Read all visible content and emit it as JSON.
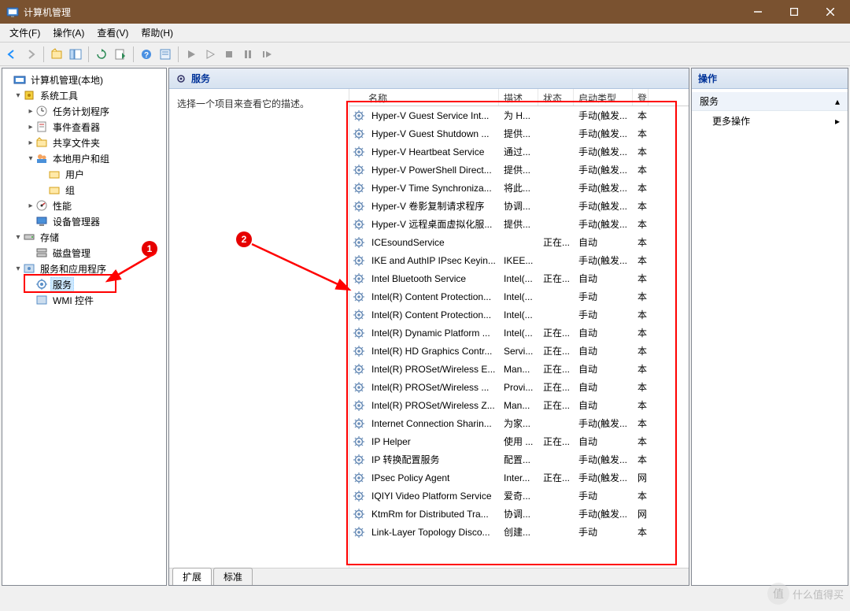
{
  "window": {
    "title": "计算机管理"
  },
  "menus": [
    "文件(F)",
    "操作(A)",
    "查看(V)",
    "帮助(H)"
  ],
  "tree": {
    "root": "计算机管理(本地)",
    "system_tools": "系统工具",
    "task_scheduler": "任务计划程序",
    "event_viewer": "事件查看器",
    "shared_folders": "共享文件夹",
    "local_users": "本地用户和组",
    "users": "用户",
    "groups": "组",
    "performance": "性能",
    "device_manager": "设备管理器",
    "storage": "存储",
    "disk_management": "磁盘管理",
    "services_apps": "服务和应用程序",
    "services": "服务",
    "wmi": "WMI 控件"
  },
  "center": {
    "header": "服务",
    "hint": "选择一个项目来查看它的描述。",
    "columns": {
      "name": "名称",
      "desc": "描述",
      "status": "状态",
      "startup": "启动类型",
      "logon": "登"
    },
    "tabs": {
      "extended": "扩展",
      "standard": "标准"
    }
  },
  "services_list": [
    {
      "name": "Hyper-V Guest Service Int...",
      "desc": "为 H...",
      "status": "",
      "startup": "手动(触发...",
      "logon": "本"
    },
    {
      "name": "Hyper-V Guest Shutdown ...",
      "desc": "提供...",
      "status": "",
      "startup": "手动(触发...",
      "logon": "本"
    },
    {
      "name": "Hyper-V Heartbeat Service",
      "desc": "通过...",
      "status": "",
      "startup": "手动(触发...",
      "logon": "本"
    },
    {
      "name": "Hyper-V PowerShell Direct...",
      "desc": "提供...",
      "status": "",
      "startup": "手动(触发...",
      "logon": "本"
    },
    {
      "name": "Hyper-V Time Synchroniza...",
      "desc": "将此...",
      "status": "",
      "startup": "手动(触发...",
      "logon": "本"
    },
    {
      "name": "Hyper-V 卷影复制请求程序",
      "desc": "协调...",
      "status": "",
      "startup": "手动(触发...",
      "logon": "本"
    },
    {
      "name": "Hyper-V 远程桌面虚拟化服...",
      "desc": "提供...",
      "status": "",
      "startup": "手动(触发...",
      "logon": "本"
    },
    {
      "name": "ICEsoundService",
      "desc": "",
      "status": "正在...",
      "startup": "自动",
      "logon": "本"
    },
    {
      "name": "IKE and AuthIP IPsec Keyin...",
      "desc": "IKEE...",
      "status": "",
      "startup": "手动(触发...",
      "logon": "本"
    },
    {
      "name": "Intel Bluetooth Service",
      "desc": "Intel(...",
      "status": "正在...",
      "startup": "自动",
      "logon": "本"
    },
    {
      "name": "Intel(R) Content Protection...",
      "desc": "Intel(...",
      "status": "",
      "startup": "手动",
      "logon": "本"
    },
    {
      "name": "Intel(R) Content Protection...",
      "desc": "Intel(...",
      "status": "",
      "startup": "手动",
      "logon": "本"
    },
    {
      "name": "Intel(R) Dynamic Platform ...",
      "desc": "Intel(...",
      "status": "正在...",
      "startup": "自动",
      "logon": "本"
    },
    {
      "name": "Intel(R) HD Graphics Contr...",
      "desc": "Servi...",
      "status": "正在...",
      "startup": "自动",
      "logon": "本"
    },
    {
      "name": "Intel(R) PROSet/Wireless E...",
      "desc": "Man...",
      "status": "正在...",
      "startup": "自动",
      "logon": "本"
    },
    {
      "name": "Intel(R) PROSet/Wireless ...",
      "desc": "Provi...",
      "status": "正在...",
      "startup": "自动",
      "logon": "本"
    },
    {
      "name": "Intel(R) PROSet/Wireless Z...",
      "desc": "Man...",
      "status": "正在...",
      "startup": "自动",
      "logon": "本"
    },
    {
      "name": "Internet Connection Sharin...",
      "desc": "为家...",
      "status": "",
      "startup": "手动(触发...",
      "logon": "本"
    },
    {
      "name": "IP Helper",
      "desc": "使用 ...",
      "status": "正在...",
      "startup": "自动",
      "logon": "本"
    },
    {
      "name": "IP 转换配置服务",
      "desc": "配置...",
      "status": "",
      "startup": "手动(触发...",
      "logon": "本"
    },
    {
      "name": "IPsec Policy Agent",
      "desc": "Inter...",
      "status": "正在...",
      "startup": "手动(触发...",
      "logon": "网"
    },
    {
      "name": "IQIYI Video Platform Service",
      "desc": "爱奇...",
      "status": "",
      "startup": "手动",
      "logon": "本"
    },
    {
      "name": "KtmRm for Distributed Tra...",
      "desc": "协调...",
      "status": "",
      "startup": "手动(触发...",
      "logon": "网"
    },
    {
      "name": "Link-Layer Topology Disco...",
      "desc": "创建...",
      "status": "",
      "startup": "手动",
      "logon": "本"
    }
  ],
  "actions": {
    "header": "操作",
    "section": "服务",
    "more": "更多操作"
  },
  "watermark": {
    "badge": "值",
    "text": "什么值得买"
  }
}
